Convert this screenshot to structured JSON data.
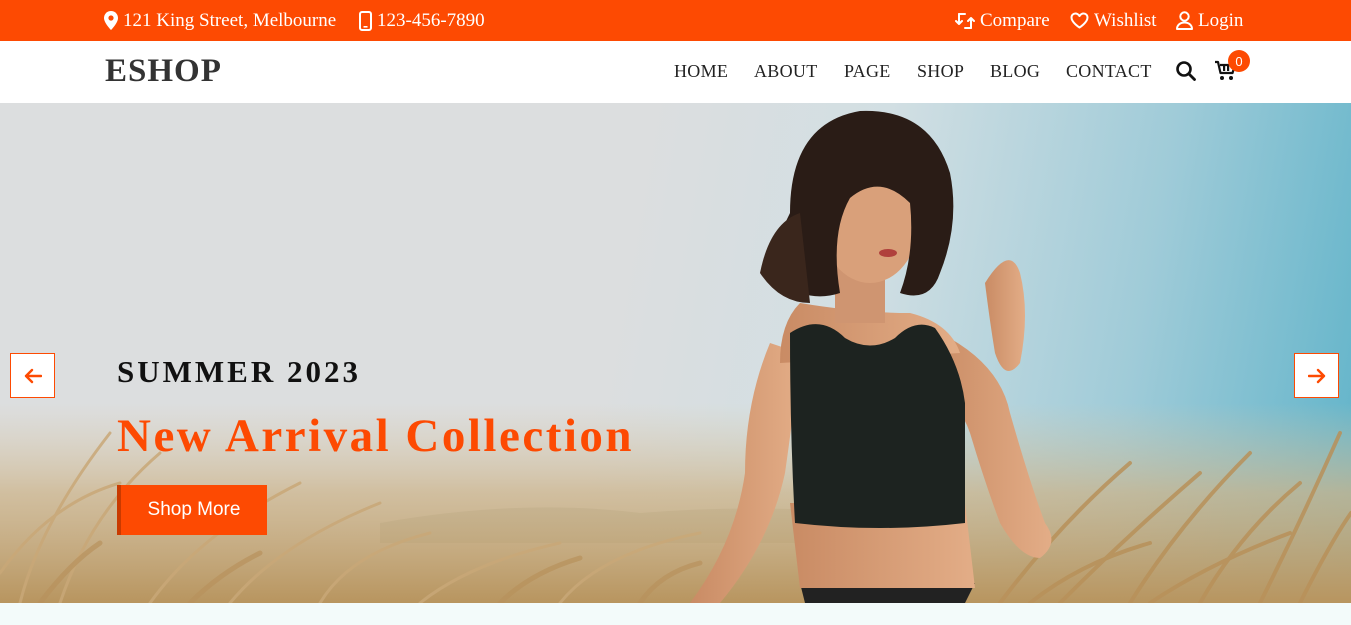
{
  "topbar": {
    "address": "121 King Street, Melbourne",
    "phone": "123-456-7890",
    "compare_label": "Compare",
    "wishlist_label": "Wishlist",
    "login_label": "Login",
    "background_color": "#fd4a02"
  },
  "nav": {
    "logo": "ESHOP",
    "links": [
      "HOME",
      "ABOUT",
      "PAGE",
      "SHOP",
      "BLOG",
      "CONTACT"
    ],
    "cart_count": "0",
    "search_icon": "search-icon",
    "cart_icon": "cart-icon"
  },
  "hero": {
    "subtitle": "SUMMER 2023",
    "title": "New Arrival Collection",
    "button_label": "Shop More",
    "accent_color": "#fd4a02",
    "prev_icon": "arrow-left-icon",
    "next_icon": "arrow-right-icon"
  }
}
